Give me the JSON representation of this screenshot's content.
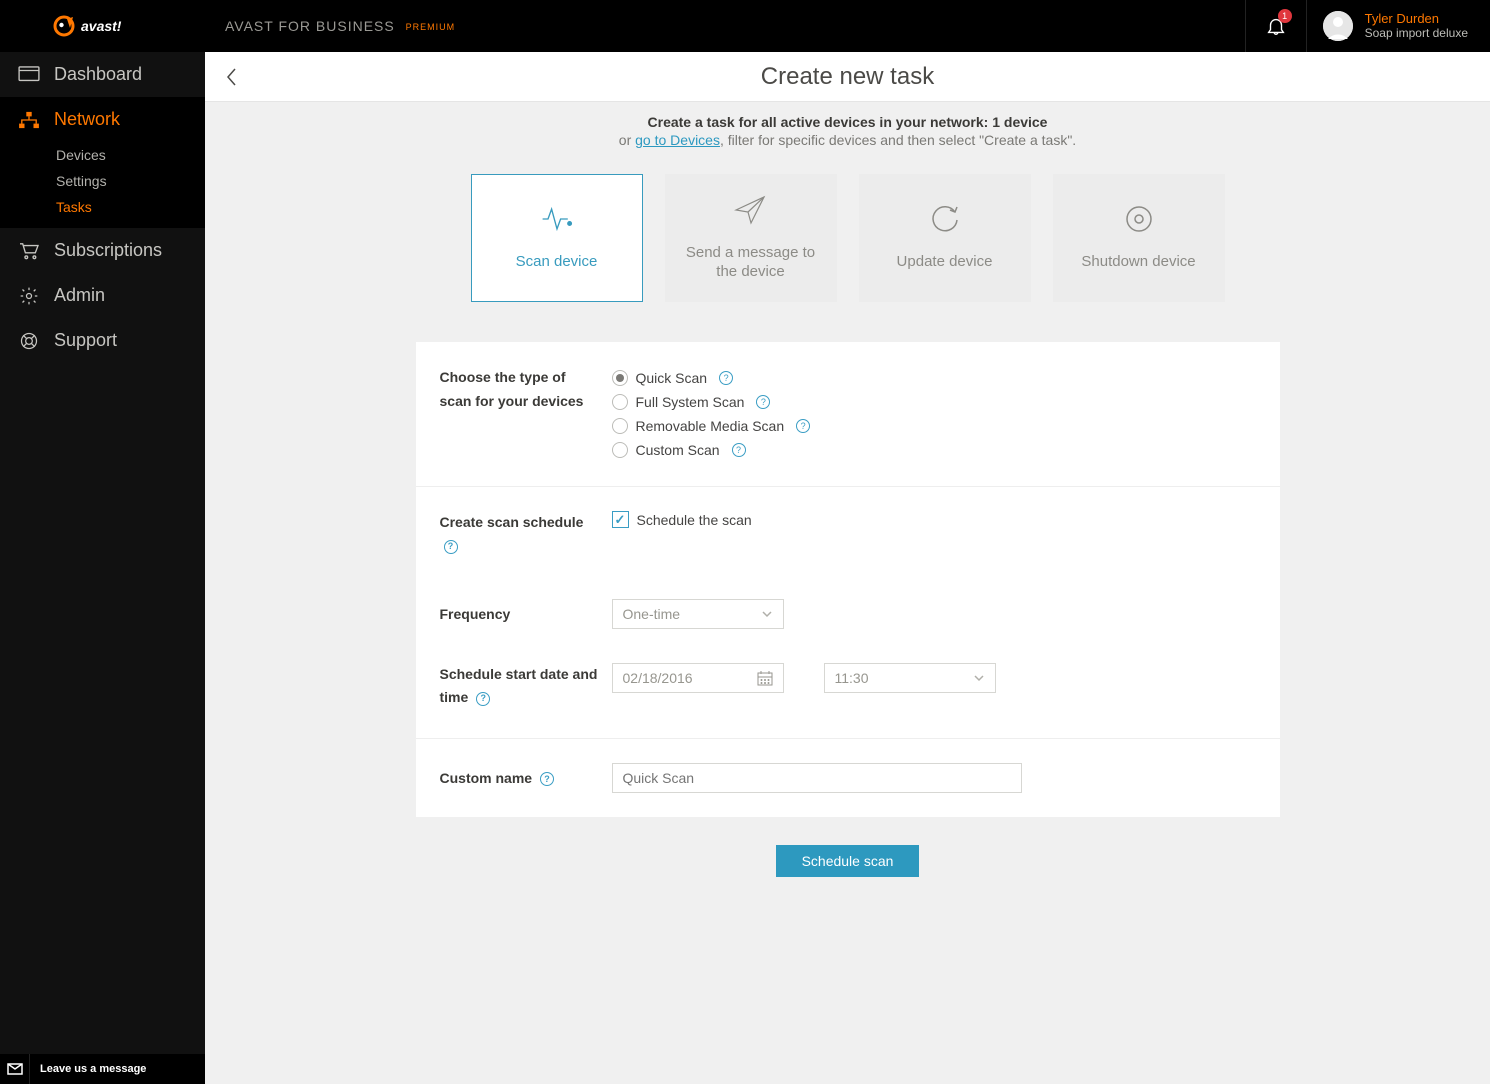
{
  "header": {
    "product": "AVAST FOR BUSINESS",
    "premium": "PREMIUM",
    "notification_count": "1",
    "user_name": "Tyler Durden",
    "user_sub": "Soap import deluxe"
  },
  "sidebar": {
    "dashboard": "Dashboard",
    "network": "Network",
    "network_sub": {
      "devices": "Devices",
      "settings": "Settings",
      "tasks": "Tasks"
    },
    "subscriptions": "Subscriptions",
    "admin": "Admin",
    "support": "Support",
    "chat": "Leave us a message"
  },
  "page": {
    "title": "Create new task",
    "intro_bold": "Create a task for all active devices in your network: 1 device",
    "intro_prefix": "or ",
    "intro_link": "go to Devices",
    "intro_suffix": ", filter for specific devices and then select \"Create a task\"."
  },
  "task_types": {
    "scan": "Scan device",
    "message": "Send a message to the device",
    "update": "Update device",
    "shutdown": "Shutdown device"
  },
  "form": {
    "scan_type_label": "Choose the type of scan for your devices",
    "scan_options": {
      "quick": "Quick Scan",
      "full": "Full System Scan",
      "removable": "Removable Media Scan",
      "custom": "Custom Scan"
    },
    "schedule_label": "Create scan schedule",
    "schedule_checkbox": "Schedule the scan",
    "frequency_label": "Frequency",
    "frequency_value": "One-time",
    "start_label": "Schedule start date and time",
    "start_date": "02/18/2016",
    "start_time": "11:30",
    "custom_name_label": "Custom name",
    "custom_name_placeholder": "Quick Scan",
    "submit": "Schedule scan"
  }
}
